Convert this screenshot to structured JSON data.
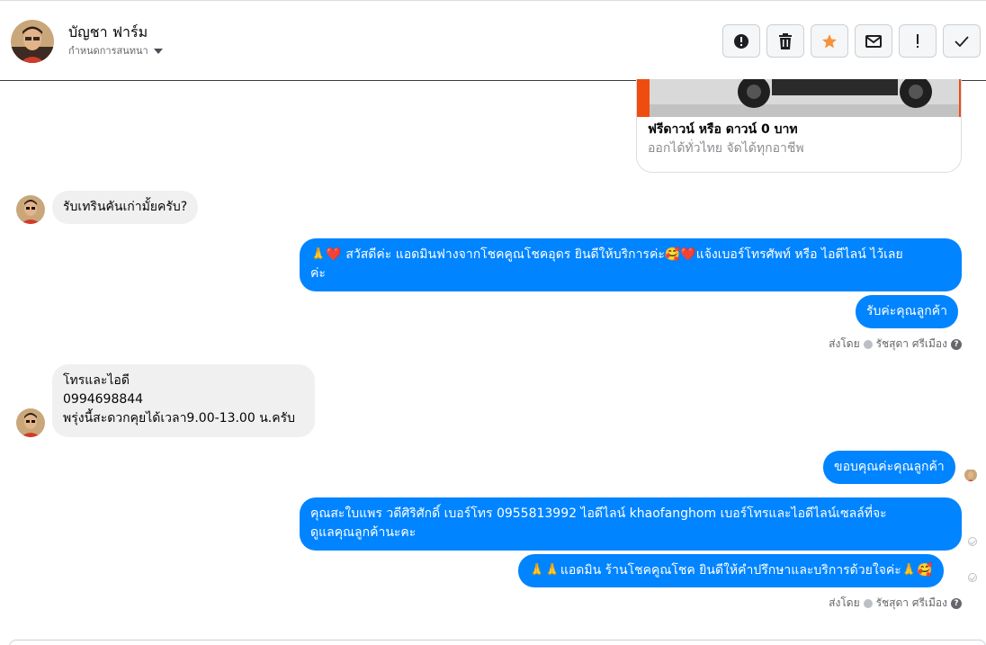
{
  "header": {
    "contact_name": "บัญชา ฟาร์ม",
    "assign_label": "กำหนดการสนทนา",
    "actions": [
      "alert-icon",
      "trash-icon",
      "star-icon",
      "mail-icon",
      "exclamation-icon",
      "check-icon"
    ],
    "star_color": "#f7923b"
  },
  "card": {
    "title": "ฟรีดาวน์ หรือ ดาวน์ 0 บาท",
    "subtitle": "ออกได้ทั่วไทย จัดได้ทุกอาชีพ"
  },
  "messages": {
    "m1": "รับเทรินคันเก่ามั้ยครับ?",
    "m2_line1": "🙏❤️ สวัสดีค่ะ แอดมินฟางจากโชคคูณโชคอุดร ยินดีให้บริการค่ะ🥰❤️แจ้งเบอร์โทรศัพท์ หรือ ไอดีไลน์  ไว้เลย",
    "m2_line2": "ค่ะ",
    "m3": "รับค่ะคุณลูกค้า",
    "sent_by_1": "ส่งโดย",
    "sender_1": "รัชสุดา ศรีเมือง",
    "m4_line1": "โทรและไอดี",
    "m4_line2": "0994698844",
    "m4_line3": "พรุ่งนี้สะดวกคุยได้เวลา9.00-13.00 น.ครับ",
    "m5": "ขอบคุณค่ะคุณลูกค้า",
    "m6_line1": "คุณสะใบแพร วดีศิริศักดิ์ เบอร์โทร 0955813992  ไอดีไลน์  khaofanghom  เบอร์โทรและไอดีไลน์เซลล์ที่จะ",
    "m6_line2": "ดูแลคุณลูกค้านะคะ",
    "m7": "🙏🙏แอดมิน ร้านโชคคูณโชค ยินดีให้คำปรึกษาและบริการด้วยใจค่ะ🙏🥰",
    "sent_by_2": "ส่งโดย",
    "sender_2": "รัชสุดา ศรีเมือง"
  },
  "colors": {
    "outgoing": "#0084ff",
    "incoming": "#f0f0f0"
  }
}
